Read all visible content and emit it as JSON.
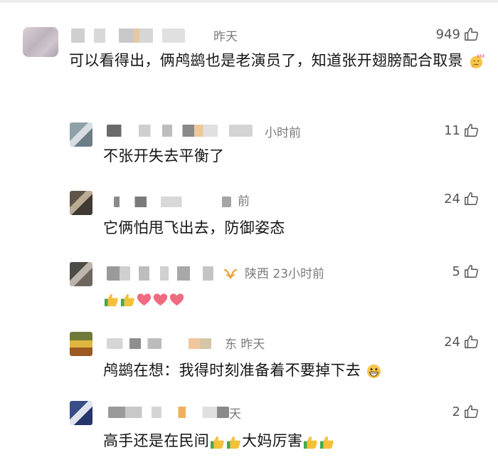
{
  "comments": [
    {
      "time": "昨天",
      "likes": "949",
      "text": "可以看得出，俩鸬鹚也是老演员了，知道张开翅膀配合取景"
    }
  ],
  "replies": [
    {
      "time": "小时前",
      "likes": "11",
      "text": "不张开失去平衡了"
    },
    {
      "time": "前",
      "likes": "24",
      "text": "它俩怕甩飞出去，防御姿态"
    },
    {
      "time": "陕西 23小时前",
      "likes": "5",
      "text": ""
    },
    {
      "time": "东 昨天",
      "likes": "24",
      "text": "鸬鹚在想：我得时刻准备着不要掉下去"
    },
    {
      "time": "天",
      "likes": "2",
      "text_part1": "高手还是在民间",
      "text_part2": "大妈厉害"
    }
  ],
  "icons": {
    "like": "thumbs-up-outline-icon",
    "vip_badge": "vip-wings-icon",
    "emoji_thinking": "thinking-face-666-emoji",
    "emoji_thumbs": "thumbs-up-emoji",
    "emoji_heart": "heart-emoji",
    "emoji_grin": "grinning-face-emoji"
  },
  "colors": {
    "meta_gray": "#7a7a7a",
    "like_gray": "#555555",
    "vip_gold": "#e8a23a",
    "heart_red": "#f06b80"
  }
}
